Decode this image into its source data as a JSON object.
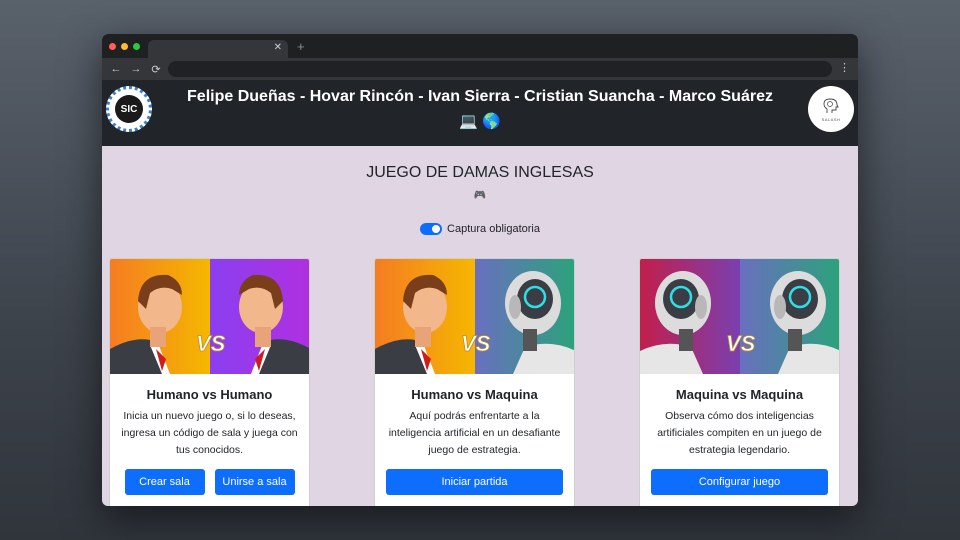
{
  "header": {
    "title": "Felipe Dueñas - Hovar Rincón - Ivan Sierra - Cristian Suancha - Marco Suárez",
    "emoji": "💻 🌎",
    "logo_left_text": "SIC",
    "logo_right_text": "SALASH"
  },
  "game": {
    "title": "JUEGO DE DAMAS INGLESAS",
    "title_emoji": "🎮"
  },
  "toggle": {
    "label": "Captura obligatoria",
    "checked": true
  },
  "cards": [
    {
      "title": "Humano vs Humano",
      "text": "Inicia un nuevo juego o, si lo deseas, ingresa un código de sala y juega con tus conocidos.",
      "buttons": [
        "Crear sala",
        "Unirse a sala"
      ]
    },
    {
      "title": "Humano vs Maquina",
      "text": "Aquí podrás enfrentarte a la inteligencia artificial en un desafiante juego de estrategia.",
      "buttons": [
        "Iniciar partida"
      ]
    },
    {
      "title": "Maquina vs Maquina",
      "text": "Observa cómo dos inteligencias artificiales compiten en un juego de estrategia legendario.",
      "buttons": [
        "Configurar juego"
      ]
    }
  ],
  "colors": {
    "accent": "#0d6efd",
    "header_bg": "#212529",
    "page_bg": "#e0d5e3"
  }
}
